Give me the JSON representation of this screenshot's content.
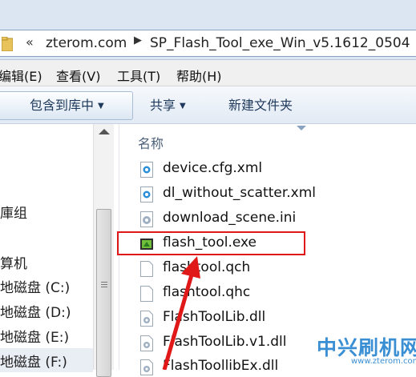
{
  "address_bar": {
    "overflow": "«",
    "segments": [
      "zterom.com",
      "SP_Flash_Tool_exe_Win_v5.1612_0504"
    ]
  },
  "menu": [
    "编辑(E)",
    "查看(V)",
    "工具(T)",
    "帮助(H)"
  ],
  "toolbar": {
    "include_library": "包含到库中",
    "share": "共享",
    "new_folder": "新建文件夹"
  },
  "nav": {
    "items": [
      "庫组",
      "算机",
      "地磁盘 (C:)",
      "地磁盘 (D:)",
      "地磁盘 (E:)",
      "地磁盘 (F:)"
    ]
  },
  "file_list": {
    "column_header": "名称",
    "files": [
      {
        "name": "device.cfg.xml",
        "icon": "xml-file-icon"
      },
      {
        "name": "dl_without_scatter.xml",
        "icon": "xml-file-icon"
      },
      {
        "name": "download_scene.ini",
        "icon": "settings-file-icon"
      },
      {
        "name": "flash_tool.exe",
        "icon": "exe-file-icon"
      },
      {
        "name": "flashtool.qch",
        "icon": "blank-file-icon"
      },
      {
        "name": "flashtool.qhc",
        "icon": "blank-file-icon"
      },
      {
        "name": "FlashToolLib.dll",
        "icon": "dll-file-icon"
      },
      {
        "name": "FlashToolLib.v1.dll",
        "icon": "dll-file-icon"
      },
      {
        "name": "FlashToollibEx.dll",
        "icon": "dll-file-icon"
      }
    ]
  },
  "watermark": {
    "text": "中兴刷机网",
    "url": "www.zterom.com"
  },
  "colors": {
    "highlight": "#e01818",
    "accent": "#3a8fd4"
  }
}
